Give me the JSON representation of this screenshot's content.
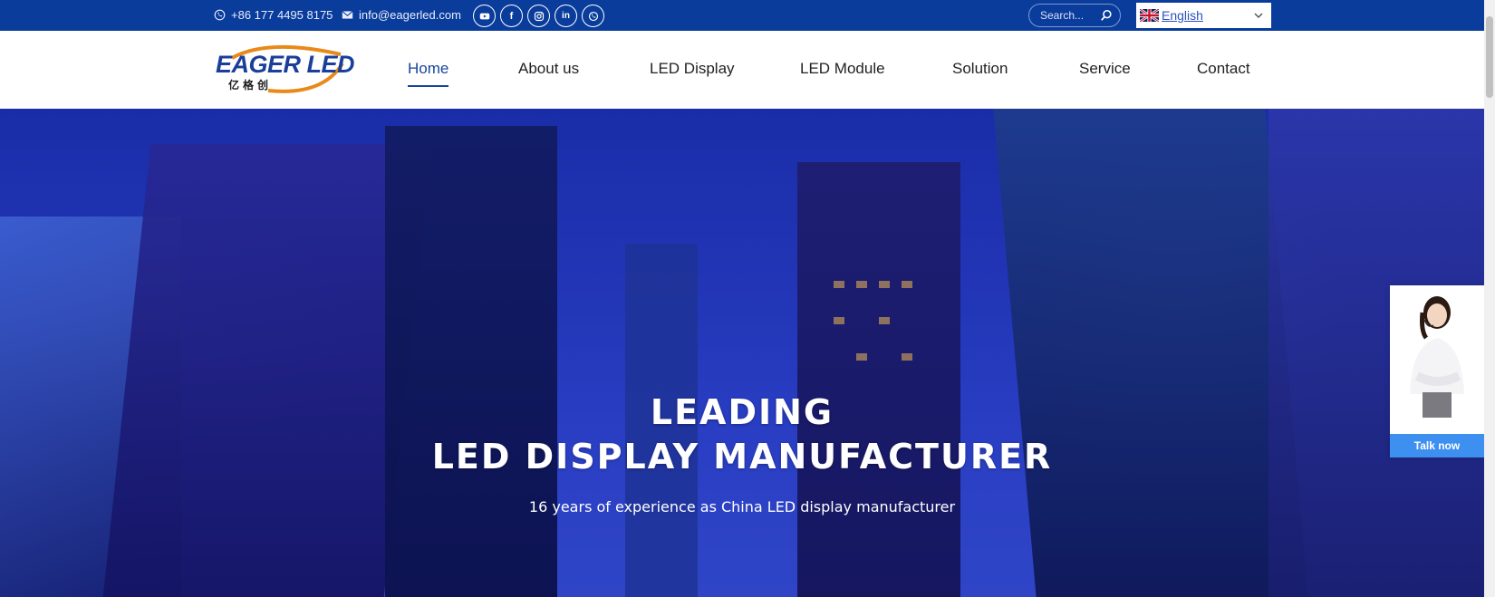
{
  "topbar": {
    "phone": "+86 177 4495 8175",
    "email": "info@eagerled.com",
    "socials": [
      "youtube-icon",
      "facebook-icon",
      "instagram-icon",
      "linkedin-icon",
      "whatsapp-icon"
    ],
    "search_placeholder": "Search...",
    "language": "English"
  },
  "logo": {
    "text": "EAGER LED",
    "sub": "亿格创"
  },
  "nav": [
    {
      "label": "Home",
      "active": true
    },
    {
      "label": "About us"
    },
    {
      "label": "LED Display"
    },
    {
      "label": "LED Module"
    },
    {
      "label": "Solution"
    },
    {
      "label": "Service"
    },
    {
      "label": "Contact"
    }
  ],
  "hero": {
    "title_line1": "LEADING",
    "title_line2": "LED DISPLAY MANUFACTURER",
    "subtitle": "16 years of experience as China LED display manufacturer"
  },
  "chat": {
    "button_label": "Talk now"
  },
  "colors": {
    "topbar": "#0a3c9c",
    "nav_active": "#15449a",
    "chat_button": "#3d8ff0"
  }
}
